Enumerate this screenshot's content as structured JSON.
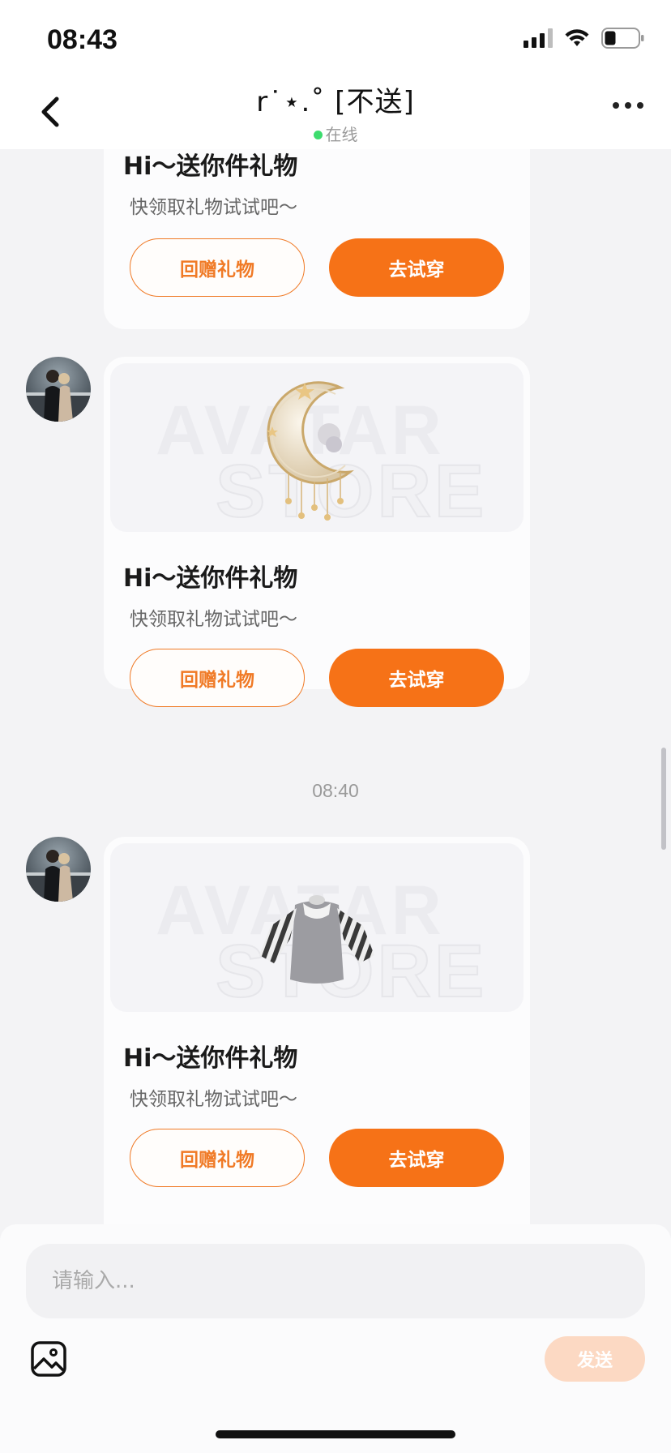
{
  "status_bar": {
    "time": "08:43"
  },
  "header": {
    "title": "r˙⋆.˚ [不送]",
    "online_status": "在线"
  },
  "messages": [
    {
      "title": "Hi～送你件礼物",
      "subtitle": "快领取礼物试试吧～",
      "return_gift_label": "回赠礼物",
      "try_on_label": "去试穿"
    },
    {
      "title": "Hi～送你件礼物",
      "subtitle": "快领取礼物试试吧～",
      "return_gift_label": "回赠礼物",
      "try_on_label": "去试穿",
      "image_watermark": [
        "AVATAR",
        "STORE"
      ],
      "item": "moon-hair-accessory"
    },
    {
      "time": "08:40"
    },
    {
      "title": "Hi～送你件礼物",
      "subtitle": "快领取礼物试试吧～",
      "return_gift_label": "回赠礼物",
      "try_on_label": "去试穿",
      "image_watermark": [
        "AVATAR",
        "STORE"
      ],
      "item": "striped-sleeve-top"
    }
  ],
  "input": {
    "placeholder": "请输入...",
    "send_label": "发送"
  },
  "colors": {
    "accent": "#f67217",
    "send_disabled": "#fcd9c3",
    "online": "#3ddc6e"
  },
  "icons": [
    "back-arrow-icon",
    "more-icon",
    "image-icon",
    "signal-icon",
    "wifi-icon",
    "battery-icon"
  ]
}
